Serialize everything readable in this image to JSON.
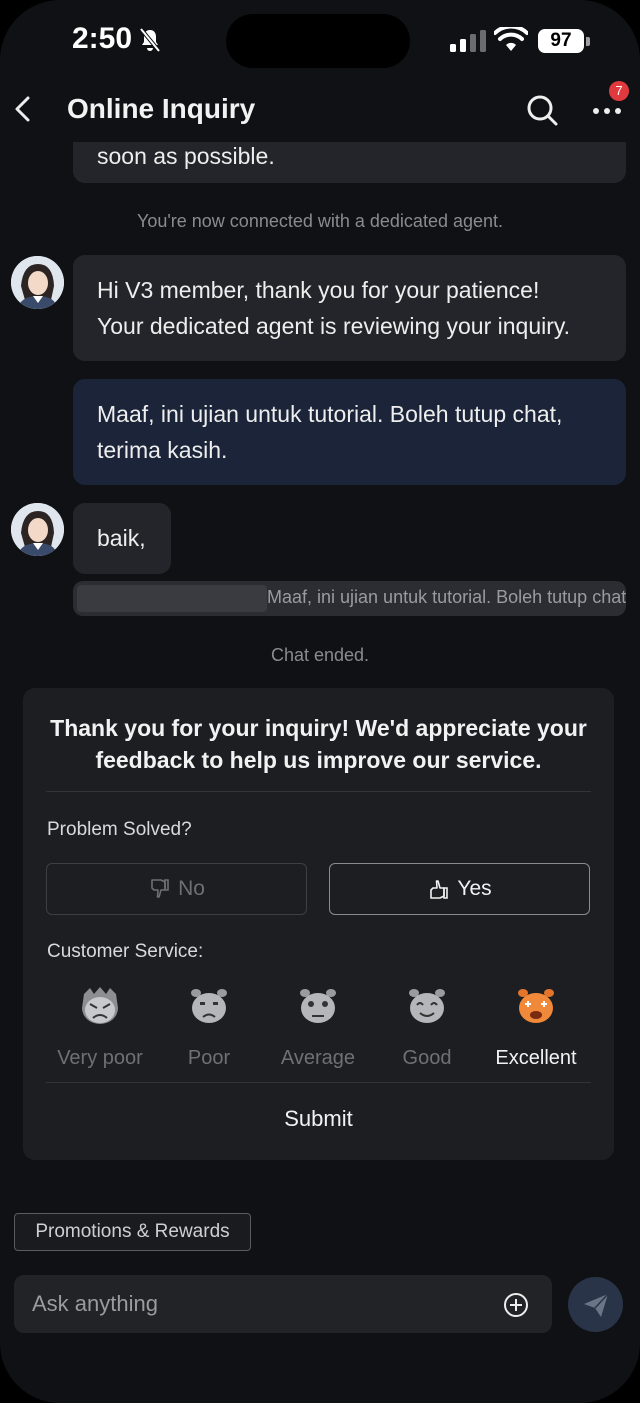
{
  "status": {
    "time": "2:50",
    "battery": "97"
  },
  "header": {
    "title": "Online Inquiry",
    "badge": "7"
  },
  "messages": {
    "top_partial": "soon as possible.",
    "connected": "You're now connected with a dedicated agent.",
    "agent_1_line1": "Hi V3 member, thank you for your patience!",
    "agent_1_line2": "Your dedicated agent is reviewing your inquiry.",
    "user_1_line1": "Maaf, ini ujian untuk tutorial. Boleh tutup chat,",
    "user_1_line2": "terima kasih.",
    "agent_2": "baik,",
    "reply_ref": "Maaf, ini ujian untuk tutorial. Boleh tutup chat,...",
    "ended": "Chat ended."
  },
  "feedback": {
    "heading_line1": "Thank you for your inquiry! We'd appreciate your",
    "heading_line2": "feedback to help us improve our service.",
    "problem_label": "Problem Solved?",
    "no_label": "No",
    "yes_label": "Yes",
    "service_label": "Customer Service:",
    "ratings": [
      "Very poor",
      "Poor",
      "Average",
      "Good",
      "Excellent"
    ],
    "selected_rating": "Excellent",
    "submit_label": "Submit"
  },
  "footer": {
    "chip": "Promotions & Rewards",
    "input_placeholder": "Ask anything"
  },
  "colors": {
    "accent": "#e03a3e",
    "user_bubble": "#1b2438",
    "selected_face": "#f08a3a"
  }
}
